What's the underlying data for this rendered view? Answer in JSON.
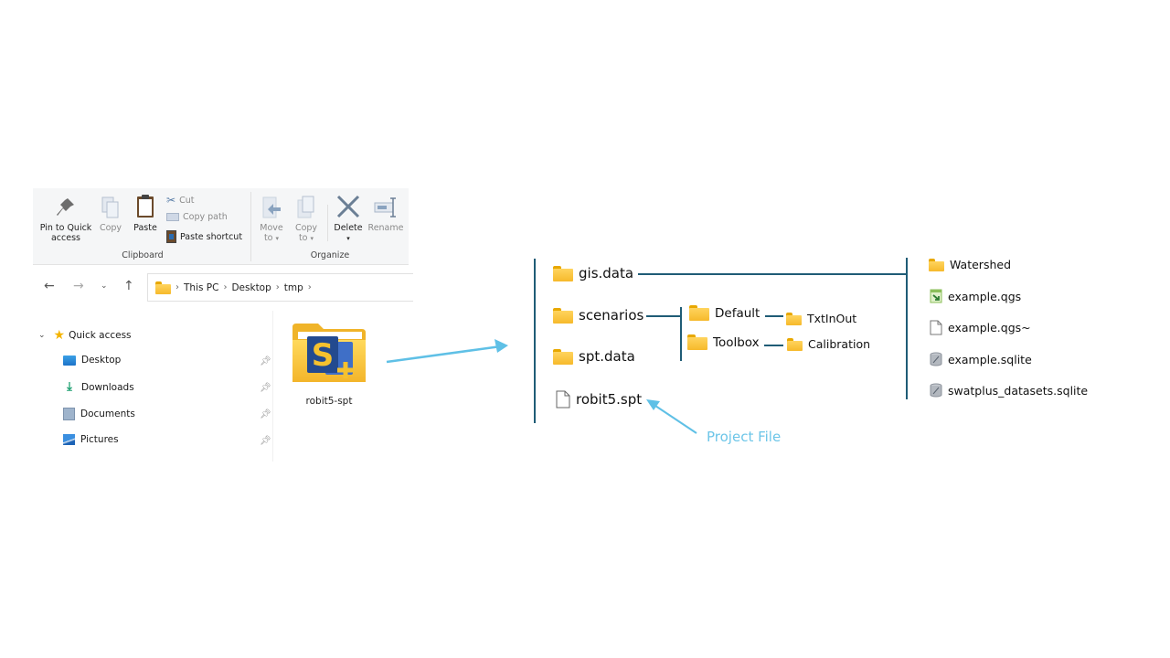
{
  "explorer": {
    "ribbon": {
      "clipboard": {
        "group_label": "Clipboard",
        "pin_label_line1": "Pin to Quick",
        "pin_label_line2": "access",
        "copy_label": "Copy",
        "paste_label": "Paste",
        "cut_label": "Cut",
        "copy_path_label": "Copy path",
        "paste_shortcut_label": "Paste shortcut"
      },
      "organize": {
        "group_label": "Organize",
        "move_to_line1": "Move",
        "move_to_line2": "to",
        "copy_to_line1": "Copy",
        "copy_to_line2": "to",
        "delete_label": "Delete",
        "rename_label": "Rename"
      }
    },
    "address_bar": {
      "breadcrumbs": [
        "This PC",
        "Desktop",
        "tmp"
      ]
    },
    "nav_pane": {
      "quick_access_label": "Quick access",
      "items": [
        {
          "label": "Desktop",
          "icon": "desktop-icon"
        },
        {
          "label": "Downloads",
          "icon": "download-icon"
        },
        {
          "label": "Documents",
          "icon": "documents-icon"
        },
        {
          "label": "Pictures",
          "icon": "pictures-icon"
        }
      ]
    },
    "content": {
      "folder_name": "robit5-spt",
      "folder_badge_letter": "S"
    }
  },
  "tree": {
    "root_items": [
      {
        "label": "gis.data",
        "type": "folder"
      },
      {
        "label": "scenarios",
        "type": "folder"
      },
      {
        "label": "spt.data",
        "type": "folder"
      },
      {
        "label": "robit5.spt",
        "type": "file"
      }
    ],
    "scenarios_children": [
      {
        "label": "Default",
        "type": "folder",
        "child": "TxtInOut"
      },
      {
        "label": "Toolbox",
        "type": "folder",
        "child": "Calibration"
      }
    ],
    "gis_children": [
      {
        "label": "Watershed",
        "type": "folder"
      },
      {
        "label": "example.qgs",
        "type": "qgis-file"
      },
      {
        "label": "example.qgs~",
        "type": "file"
      },
      {
        "label": "example.sqlite",
        "type": "database"
      },
      {
        "label": "swatplus_datasets.sqlite",
        "type": "database"
      }
    ],
    "annotation": "Project File"
  },
  "colors": {
    "tree_line": "#1f5c76",
    "arrow": "#5fc0e6",
    "annotation": "#6cc5e8",
    "folder": "#f6b92b"
  }
}
